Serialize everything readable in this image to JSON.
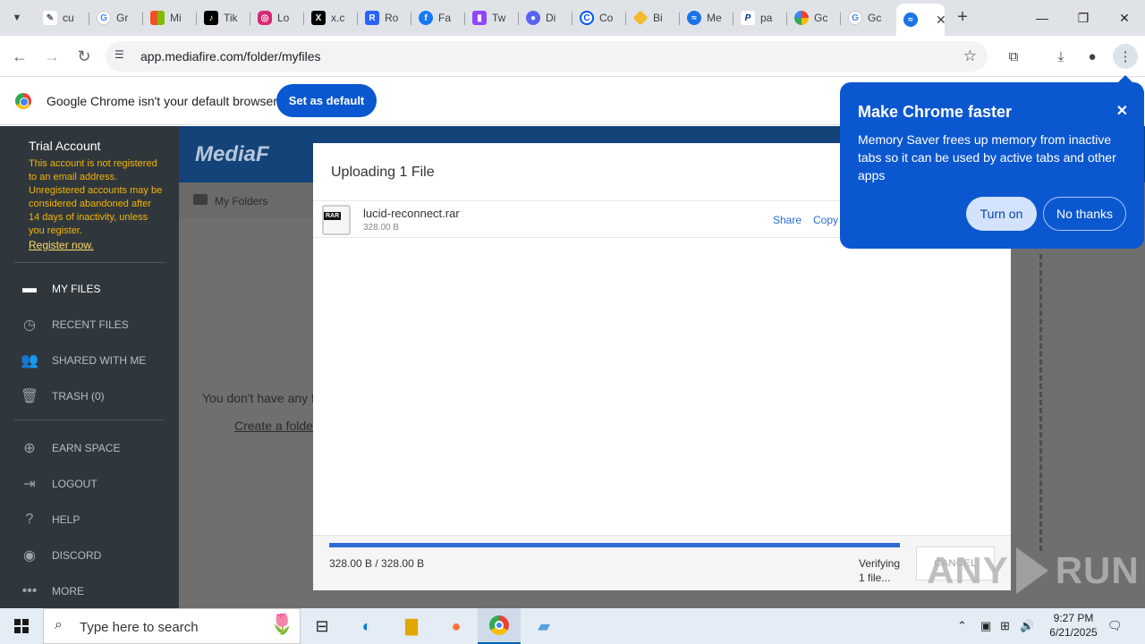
{
  "browser": {
    "tabs": [
      {
        "label": "cu",
        "icon": "edit-icon",
        "color": "#5f6368"
      },
      {
        "label": "Gr",
        "icon": "google-icon",
        "color": "#4285f4"
      },
      {
        "label": "Mi",
        "icon": "microsoft-icon",
        "color": "#f25022"
      },
      {
        "label": "Tik",
        "icon": "tiktok-icon",
        "color": "#000000"
      },
      {
        "label": "Lo",
        "icon": "instagram-icon",
        "color": "#d62976"
      },
      {
        "label": "x.c",
        "icon": "x-icon",
        "color": "#000000"
      },
      {
        "label": "Ro",
        "icon": "roblox-icon",
        "color": "#2962ff"
      },
      {
        "label": "Fa",
        "icon": "facebook-icon",
        "color": "#1877f2"
      },
      {
        "label": "Tw",
        "icon": "twitch-icon",
        "color": "#9146ff"
      },
      {
        "label": "Di",
        "icon": "discord-icon",
        "color": "#5865f2"
      },
      {
        "label": "Co",
        "icon": "coinbase-icon",
        "color": "#0052ff"
      },
      {
        "label": "Bi",
        "icon": "binance-icon",
        "color": "#f3ba2f"
      },
      {
        "label": "Me",
        "icon": "mediafire-icon",
        "color": "#1a73e8"
      },
      {
        "label": "pa",
        "icon": "paypal-icon",
        "color": "#003087"
      },
      {
        "label": "Gc",
        "icon": "pinwheel-icon",
        "color": "#ea4335"
      },
      {
        "label": "Gc",
        "icon": "google-icon",
        "color": "#4285f4"
      }
    ],
    "active_tab_icon": "mediafire-icon",
    "new_tab": "+",
    "url": "app.mediafire.com/folder/myfiles"
  },
  "infobar": {
    "message": "Google Chrome isn't your default browser",
    "button": "Set as default"
  },
  "sidebar": {
    "account_title": "Trial Account",
    "account_warning": "This account is not registered to an email address. Unregistered accounts may be considered abandoned after 14 days of inactivity, unless you register.",
    "register_link": "Register now.",
    "nav": [
      {
        "label": "MY FILES",
        "icon": "folder-icon"
      },
      {
        "label": "RECENT FILES",
        "icon": "clock-icon"
      },
      {
        "label": "SHARED WITH ME",
        "icon": "people-icon"
      },
      {
        "label": "TRASH (0)",
        "icon": "trash-icon"
      }
    ],
    "nav2": [
      {
        "label": "EARN SPACE",
        "icon": "plus-circle-icon"
      },
      {
        "label": "LOGOUT",
        "icon": "logout-icon"
      },
      {
        "label": "HELP",
        "icon": "help-icon"
      },
      {
        "label": "DISCORD",
        "icon": "discord-icon"
      },
      {
        "label": "MORE",
        "icon": "more-icon"
      }
    ]
  },
  "main": {
    "logo": "MediaF",
    "breadcrumb": "My Folders",
    "empty_message": "You don't have any f",
    "create_folder": "Create a folde"
  },
  "upload": {
    "title": "Uploading 1 File",
    "file_name": "lucid-reconnect.rar",
    "file_size": "328.00 B",
    "file_icon_badge": "RAR",
    "share": "Share",
    "copy": "Copy",
    "progress_text": "328.00 B / 328.00 B",
    "progress_fraction": 1.0,
    "status_line1": "Verifying",
    "status_line2": "1 file...",
    "cancel": "CANCEL"
  },
  "bubble": {
    "title": "Make Chrome faster",
    "body": "Memory Saver frees up memory from inactive tabs so it can be used by active tabs and other apps",
    "turn_on": "Turn on",
    "no_thanks": "No thanks"
  },
  "watermark": {
    "left": "ANY",
    "right": "RUN"
  },
  "taskbar": {
    "search_placeholder": "Type here to search",
    "time": "9:27 PM",
    "date": "6/21/2025"
  },
  "colors": {
    "chrome_blue": "#0b57d0",
    "sidebar_bg": "#30373c",
    "warning_text": "#f4b400",
    "progress": "#2b6cd4"
  }
}
